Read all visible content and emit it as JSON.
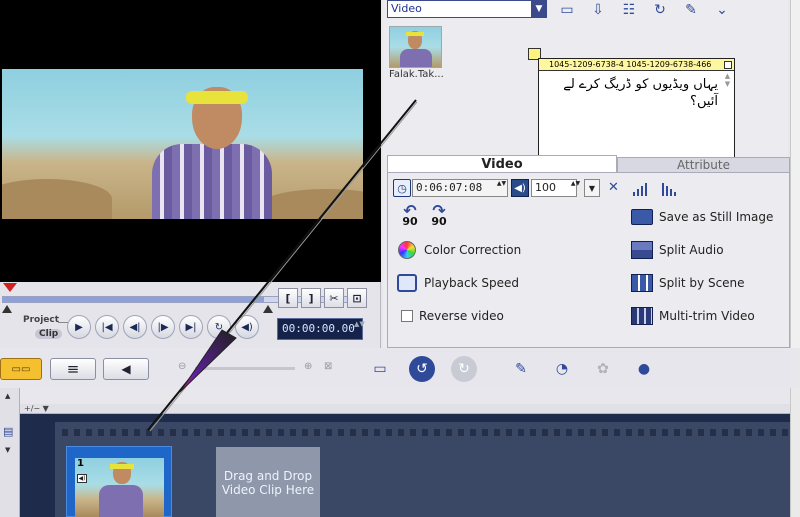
{
  "preview": {
    "mode_project": "Project",
    "mode_clip": "Clip",
    "timecode": "00:00:00.00",
    "spin": "▲▼",
    "buttons": {
      "play": "▶",
      "home": "|◀",
      "prev_frame": "◀|",
      "next_frame": "|▶",
      "end": "▶|",
      "repeat": "↻",
      "volume": "◀)"
    },
    "trim": {
      "mark_in": "[",
      "mark_out": "]",
      "cut": "✂",
      "enlarge": "⊡"
    }
  },
  "library": {
    "selected": "Video",
    "dropdown_arrow": "▼",
    "icons": [
      "folder-icon",
      "import-icon",
      "sort-icon",
      "refresh-icon",
      "options-icon",
      "expand-icon"
    ],
    "clip_caption": "Falak.Tak...",
    "icon_glyphs": {
      "folder": "▭",
      "import": "⇩",
      "sort": "☷",
      "refresh": "↻",
      "options": "✎",
      "expand": "⌄"
    }
  },
  "annotation": {
    "header": "1045-1209-6738-4  1045-1209-6738-466",
    "text": "یہاں ویڈیوں کو ڈریگ کرے لے آئیں؟",
    "scroll": "▲ ▼"
  },
  "tabs": {
    "video": "Video",
    "attribute": "Attribute"
  },
  "options": {
    "clock_glyph": "◷",
    "duration": "0:06:07:08",
    "volume_glyph": "◀)",
    "volume": "100",
    "spin": "▲▼",
    "dropdown_arrow": "▼",
    "mute_glyph": "✕",
    "rotate_left": "90",
    "rotate_right": "90",
    "rotate_left_arc": "↶",
    "rotate_right_arc": "↷",
    "color_correction": "Color Correction",
    "playback_speed": "Playback Speed",
    "reverse_video": "Reverse video",
    "save_still": "Save as Still Image",
    "split_audio": "Split Audio",
    "split_scene": "Split by Scene",
    "multi_trim": "Multi-trim Video"
  },
  "toolbar": {
    "zoom_out": "⊖",
    "zoom_in": "⊕",
    "zoom_fit": "⊠",
    "tool_glyphs": {
      "open": "▭",
      "undo": "↺",
      "redo": "↻",
      "record": "✎",
      "share": "◔",
      "smart_render": "✿",
      "create_disc": "●"
    },
    "view_glyphs": {
      "storyboard": "▭▭",
      "timeline": "≡",
      "audio": "◀"
    }
  },
  "storyboard": {
    "ruler_label": "+/−  ▼",
    "clip_number": "1",
    "clip_audio": "◀)",
    "drop_hint": "Drag and Drop Video Clip Here",
    "left_strip_glyphs": {
      "up": "▲",
      "tracks": "▤",
      "down": "▼"
    }
  }
}
